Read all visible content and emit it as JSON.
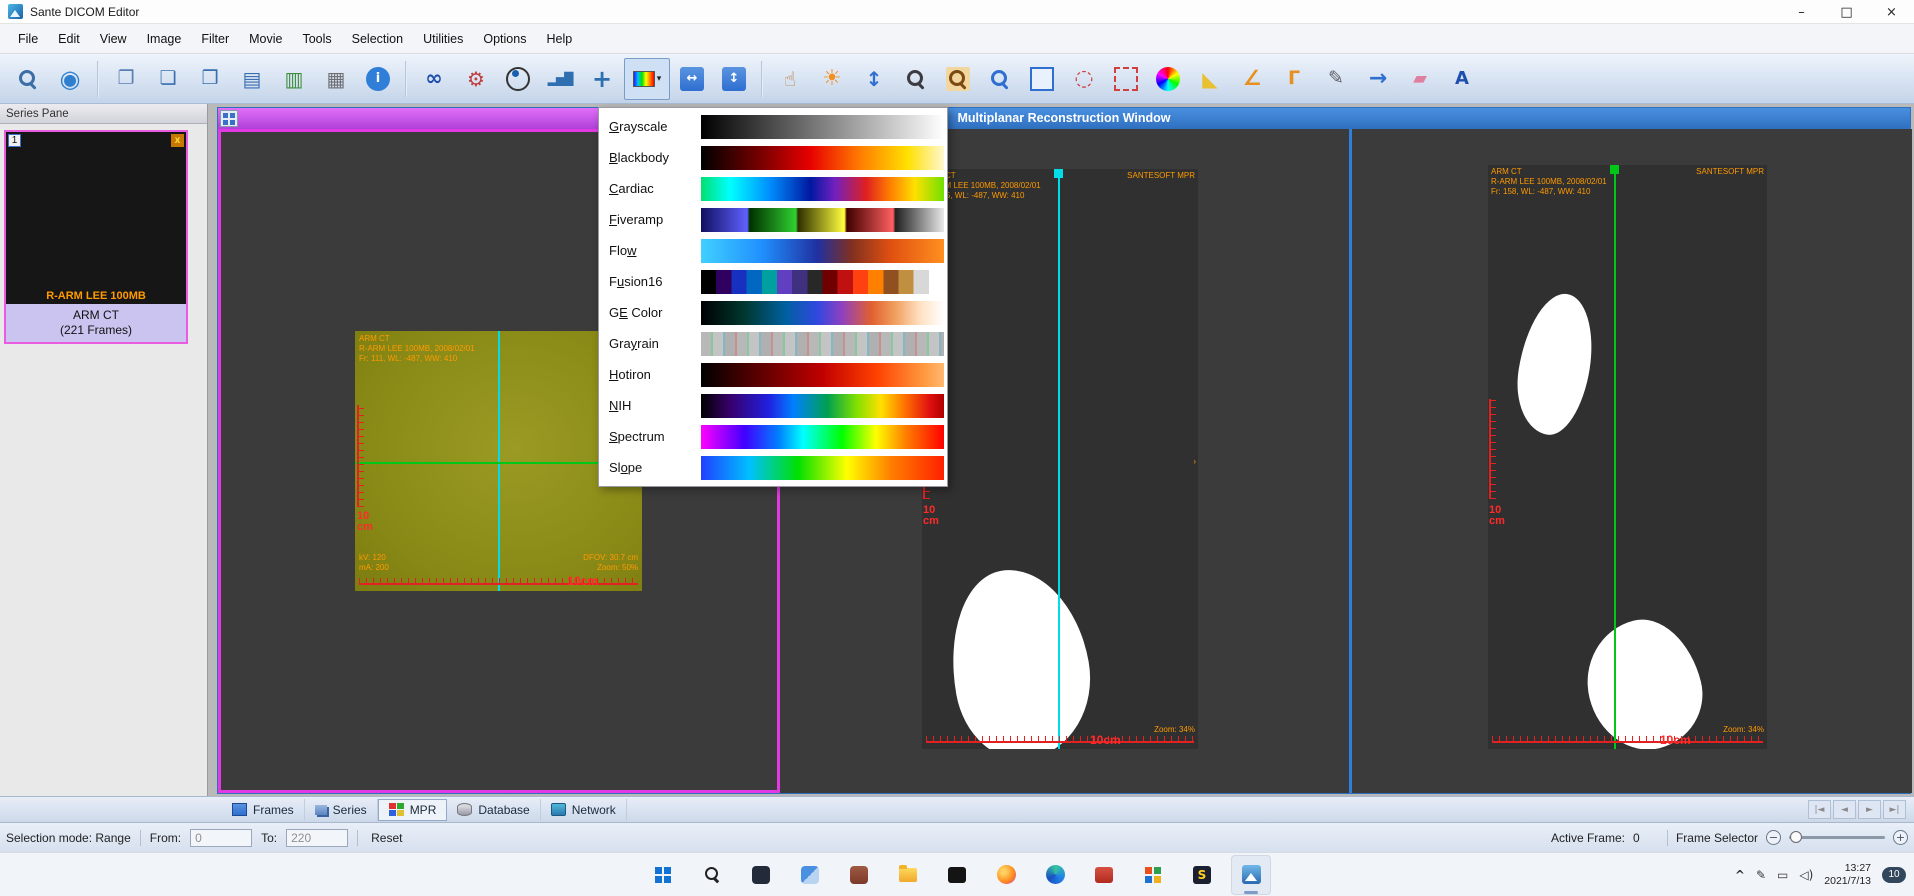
{
  "titlebar": {
    "app_title": "Sante DICOM Editor",
    "controls": [
      {
        "name": "minimize-button",
        "glyph": "–"
      },
      {
        "name": "maximize-button",
        "glyph": "□"
      },
      {
        "name": "close-button",
        "glyph": "×"
      }
    ]
  },
  "menubar": {
    "items": [
      {
        "name": "menu-file",
        "label": "File"
      },
      {
        "name": "menu-edit",
        "label": "Edit"
      },
      {
        "name": "menu-view",
        "label": "View"
      },
      {
        "name": "menu-image",
        "label": "Image"
      },
      {
        "name": "menu-filter",
        "label": "Filter"
      },
      {
        "name": "menu-movie",
        "label": "Movie"
      },
      {
        "name": "menu-tools",
        "label": "Tools"
      },
      {
        "name": "menu-selection",
        "label": "Selection"
      },
      {
        "name": "menu-utilities",
        "label": "Utilities"
      },
      {
        "name": "menu-options",
        "label": "Options"
      },
      {
        "name": "menu-help",
        "label": "Help"
      }
    ]
  },
  "toolbar": {
    "palette_caret": "▾",
    "group1": [
      {
        "name": "search-study-icon",
        "glyph": "",
        "glyph_cls": "css-mag",
        "style": "color:#3a6ea5"
      },
      {
        "name": "web-globe-icon",
        "glyph": "◉",
        "style": "color:#2e7fd0;font-size:24px"
      }
    ],
    "group2": [
      {
        "name": "copy-icon",
        "glyph": "❐",
        "style": "color:#5b7fb5;font-size:19px"
      },
      {
        "name": "open-folder-icon",
        "glyph": "❏",
        "style": "color:#3a6fb0;font-size:19px"
      },
      {
        "name": "open-folders-icon",
        "glyph": "❒",
        "style": "color:#3a6fb0;font-size:19px"
      },
      {
        "name": "import-export-icon",
        "glyph": "▤",
        "style": "color:#3a6fb0;font-size:20px"
      },
      {
        "name": "clipboard-icon",
        "glyph": "▥",
        "style": "color:#3f8f3f;font-size:20px"
      },
      {
        "name": "print-icon",
        "glyph": "▦",
        "style": "color:#6f6f74;font-size:20px"
      },
      {
        "name": "info-icon",
        "glyph": "i",
        "glyph_cls": "css-info",
        "style": ""
      }
    ],
    "group3a": [
      {
        "name": "dicom-tags-binoculars-icon",
        "glyph": "∞",
        "style": "color:#1f4fae;font-weight:bold;font-size:21px"
      },
      {
        "name": "tools-wrench-icon",
        "glyph": "⚙",
        "style": "color:#c04040;font-size:20px"
      },
      {
        "name": "view-eye-icon",
        "glyph": "",
        "glyph_cls": "css-eye",
        "style": "color:#333"
      },
      {
        "name": "histogram-icon",
        "glyph": "▂▅█",
        "style": "color:#2e6fb0;font-size:12px;letter-spacing:-1px"
      },
      {
        "name": "center-crosshair-icon",
        "glyph": "+",
        "style": "color:#2e6fb0;font-weight:bold;font-size:24px"
      }
    ],
    "group3b": [
      {
        "name": "fit-to-window-icon",
        "glyph": "↔",
        "glyph_cls": "css-expand",
        "style": ""
      },
      {
        "name": "full-screen-icon",
        "glyph": "↕",
        "glyph_cls": "css-expand",
        "style": ""
      }
    ],
    "group4": [
      {
        "name": "pan-hand-icon",
        "glyph": "☝",
        "style": "color:#b8803f;font-size:20px"
      },
      {
        "name": "brightness-sun-icon",
        "glyph": "☀",
        "style": "color:#f09020;font-size:22px"
      },
      {
        "name": "window-level-arrow-icon",
        "glyph": "↕",
        "style": "color:#2e6fd0;font-weight:bold;font-size:20px"
      },
      {
        "name": "zoom-magnifier-icon",
        "glyph": "",
        "glyph_cls": "css-mag",
        "style": "color:#3c3c40"
      },
      {
        "name": "zoom-image-icon",
        "glyph": "",
        "glyph_cls": "css-mag",
        "style": "color:#7a4a10;background:#f2d6a0;border-radius:2px"
      },
      {
        "name": "zoom-region-icon",
        "glyph": "",
        "glyph_cls": "css-mag",
        "style": "color:#2e6fd0"
      },
      {
        "name": "rect-select-icon",
        "glyph": "",
        "glyph_cls": "css-rect-blue",
        "style": ""
      },
      {
        "name": "ellipse-select-icon",
        "glyph": "◌",
        "style": "color:#d04040;font-weight:bold;font-size:22px"
      },
      {
        "name": "dashed-rect-select-icon",
        "glyph": "",
        "glyph_cls": "css-rect-dashed",
        "style": ""
      },
      {
        "name": "color-wheel-icon",
        "glyph": "",
        "glyph_cls": "css-colorwheel",
        "style": ""
      },
      {
        "name": "set-square-icon",
        "glyph": "◣",
        "style": "color:#e8c030;font-size:20px"
      },
      {
        "name": "angle-measure-icon",
        "glyph": "∠",
        "style": "color:#e88f20;font-weight:bold;font-size:21px"
      },
      {
        "name": "cobb-angle-icon",
        "glyph": "Γ",
        "style": "color:#e88f20;font-weight:bold;font-size:19px"
      },
      {
        "name": "draw-line-pencil-icon",
        "glyph": "✎",
        "style": "color:#606068;font-size:19px"
      },
      {
        "name": "arrow-annotation-icon",
        "glyph": "→",
        "style": "color:#2e6fd0;font-weight:bold;font-size:22px"
      },
      {
        "name": "eraser-icon",
        "glyph": "▰",
        "style": "color:#e080a0;font-size:18px"
      },
      {
        "name": "text-annotation-icon",
        "glyph": "A",
        "style": "color:#1f4fae;font-weight:bold;font-size:18px"
      }
    ]
  },
  "series_pane": {
    "header": "Series Pane",
    "thumb_index": "1",
    "thumb_close": "x",
    "thumb_caption": "R-ARM LEE 100MB",
    "series_title": "ARM CT",
    "series_frames": "(221 Frames)"
  },
  "mpr": {
    "title": "Multiplanar Reconstruction Window",
    "vp1": {
      "tl1": "ARM CT",
      "tl2": "R-ARM LEE 100MB, 2008/02/01",
      "tl3": "Fr: 111, WL: -487, WW: 410",
      "bl1": "kV: 120",
      "bl2": "mA: 200",
      "br1": "DFOV: 30.7 cm",
      "br2": "Zoom: 50%",
      "ruler_h": "10cm",
      "ruler_v1": "10",
      "ruler_v2": "cm"
    },
    "vp2": {
      "tl1": "ARM CT",
      "tl2": "R-ARM LEE 100MB, 2008/02/01",
      "tl3": "Fr: 255, WL: -487, WW: 410",
      "tr": "SANTESOFT MPR",
      "br": "Zoom: 34%",
      "marker": "›",
      "ruler_h": "10cm",
      "ruler_v1": "10",
      "ruler_v2": "cm"
    },
    "vp3": {
      "tl1": "ARM CT",
      "tl2": "R-ARM LEE 100MB, 2008/02/01",
      "tl3": "Fr: 158, WL: -487, WW: 410",
      "tr": "SANTESOFT MPR",
      "br": "Zoom: 34%",
      "ruler_h": "10cm",
      "ruler_v1": "10",
      "ruler_v2": "cm"
    }
  },
  "palette_menu": {
    "items": [
      {
        "name": "palette-option-grayscale",
        "pre": "",
        "key": "G",
        "post": "rayscale",
        "css": "background:linear-gradient(90deg,#000,#fff)"
      },
      {
        "name": "palette-option-blackbody",
        "pre": "",
        "key": "B",
        "post": "lackbody",
        "css": "background:linear-gradient(90deg,#000,#7a0000 25%,#e80000 45%,#ff7a00 65%,#ffe000 85%,#fff8d0)"
      },
      {
        "name": "palette-option-cardiac",
        "pre": "",
        "key": "C",
        "post": "ardiac",
        "css": "background:linear-gradient(90deg,#00e070,#00ffff 12%,#0090ff 28%,#0018a0 45%,#7020c0 55%,#e02020 68%,#ff8000 78%,#ffe000 88%,#70e000)"
      },
      {
        "name": "palette-option-fiveramp",
        "pre": "",
        "key": "F",
        "post": "iveramp",
        "css": "background:linear-gradient(90deg,#101060 0%,#6060ff 19%,#003000 20%,#30d030 39%,#303000 40%,#ffff40 59%,#400000 60%,#ff6060 79%,#202020 80%,#e8e8e8 100%)"
      },
      {
        "name": "palette-option-flow",
        "pre": "Flo",
        "key": "w",
        "post": "",
        "css": "background:linear-gradient(90deg,#40d0ff,#2090ff 25%,#2030a0 48%,#803020 62%,#e05010 78%,#ff9020)"
      },
      {
        "name": "palette-option-fusion16",
        "pre": "F",
        "key": "u",
        "post": "sion16",
        "css": "background:linear-gradient(90deg,#000 0%,#000 6.25%,#300060 6.25%,#300060 12.5%,#1830c0 12.5%,#1830c0 18.75%,#0068c0 18.75%,#0068c0 25%,#00a0a0 25%,#00a0a0 31.25%,#6040c0 31.25%,#6040c0 37.5%,#403080 37.5%,#403080 43.75%,#282828 43.75%,#282828 50%,#700000 50%,#700000 56.25%,#c01010 56.25%,#c01010 62.5%,#ff4010 62.5%,#ff4010 68.75%,#ff8000 68.75%,#ff8000 75%,#905020 75%,#905020 81.25%,#c09040 81.25%,#c09040 87.5%,#d8d8d8 87.5%,#d8d8d8 93.75%,#fff 93.75%,#fff 100%)"
      },
      {
        "name": "palette-option-ge-color",
        "pre": "G",
        "key": "E",
        "post": " Color",
        "css": "background:linear-gradient(90deg,#000,#003830 18%,#0060a0 35%,#3048e0 48%,#9040c0 58%,#e06030 70%,#f0a060 80%,#ffe0c0 90%,#fff)"
      },
      {
        "name": "palette-option-grayrain",
        "pre": "Gra",
        "key": "y",
        "post": "rain",
        "css": "background:repeating-linear-gradient(90deg,#b8b8b8 0 10px,#88c8a0 10px 12px,#c4c4c4 12px 22px,#80b8c8 22px 24px,#b0b0b0 24px 34px,#c89090 34px 36px)"
      },
      {
        "name": "palette-option-hotiron",
        "pre": "",
        "key": "H",
        "post": "otiron",
        "css": "background:linear-gradient(90deg,#000,#600000 25%,#c00000 50%,#ff4000 72%,#ff9a40 92%,#ffb870)"
      },
      {
        "name": "palette-option-nih",
        "pre": "",
        "key": "N",
        "post": "IH",
        "css": "background:linear-gradient(90deg,#000,#38006c 12%,#2020e0 28%,#0080ff 38%,#00a050 52%,#80e000 64%,#ffe000 74%,#ff7000 84%,#e01010 94%,#b00000)"
      },
      {
        "name": "palette-option-spectrum",
        "pre": "",
        "key": "S",
        "post": "pectrum",
        "css": "background:linear-gradient(90deg,#ff00ff,#4000ff 18%,#0080ff 32%,#00ffff 42%,#00ff00 58%,#ffff00 72%,#ff8000 84%,#ff0000)"
      },
      {
        "name": "palette-option-slope",
        "pre": "Sl",
        "key": "o",
        "post": "pe",
        "css": "background:linear-gradient(90deg,#2040ff,#00c0ff 20%,#00e000 40%,#ffff00 60%,#ff8000 78%,#ff2000)"
      }
    ]
  },
  "tabbar": {
    "tabs": [
      {
        "name": "tab-frames",
        "label": "Frames",
        "icon_cls": "ti-frames"
      },
      {
        "name": "tab-series",
        "label": "Series",
        "icon_cls": "ti-series"
      },
      {
        "name": "tab-mpr",
        "label": "MPR",
        "icon_cls": "ti-mpr",
        "cls": "active"
      },
      {
        "name": "tab-database",
        "label": "Database",
        "icon_cls": "ti-db"
      },
      {
        "name": "tab-network",
        "label": "Network",
        "icon_cls": "ti-net"
      }
    ],
    "nav": [
      {
        "name": "first-frame-button",
        "glyph": "|◄"
      },
      {
        "name": "prev-frame-button",
        "glyph": "◄"
      },
      {
        "name": "next-frame-button",
        "glyph": "►"
      },
      {
        "name": "last-frame-button",
        "glyph": "►|"
      }
    ]
  },
  "statusbar": {
    "selection_mode": "Selection mode: Range",
    "from_label": "From:",
    "from_value": "0",
    "to_label": "To:",
    "to_value": "220",
    "reset_label": "Reset",
    "active_frame_label": "Active Frame:",
    "active_frame_value": "0",
    "frame_selector_label": "Frame Selector",
    "minus": "−",
    "plus": "+"
  },
  "taskbar": {
    "icons": [
      {
        "name": "start-button",
        "icon_cls": "tb-start"
      },
      {
        "name": "search-button",
        "icon_cls": "tb-search"
      },
      {
        "name": "task-view-button",
        "icon_cls": "tb-dark"
      },
      {
        "name": "widgets-button",
        "icon_cls": "tb-widgets"
      },
      {
        "name": "store-button",
        "icon_cls": "tb-store"
      },
      {
        "name": "file-explorer-button",
        "icon_cls": "tb-explorer"
      },
      {
        "name": "terminal-button",
        "icon_cls": "tb-terminal"
      },
      {
        "name": "firefox-button",
        "icon_cls": "tb-firefox"
      },
      {
        "name": "edge-button",
        "icon_cls": "tb-edge"
      },
      {
        "name": "powerpoint-button",
        "icon_cls": "tb-red"
      },
      {
        "name": "office-button",
        "icon_cls": "tb-office"
      },
      {
        "name": "sante-launcher-button",
        "icon_cls": "tb-sante",
        "glyph": "S"
      },
      {
        "name": "sante-dicom-editor-button",
        "icon_cls": "tb-dicom",
        "cls": "active"
      }
    ],
    "tray_chevron": "^",
    "tray_icons": [
      {
        "name": "pen-tray-icon",
        "glyph": "✎"
      },
      {
        "name": "network-tray-icon",
        "glyph": "▭"
      },
      {
        "name": "volume-tray-icon",
        "glyph": "◁)"
      }
    ],
    "time": "13:27",
    "date": "2021/7/13",
    "badge": "10"
  }
}
